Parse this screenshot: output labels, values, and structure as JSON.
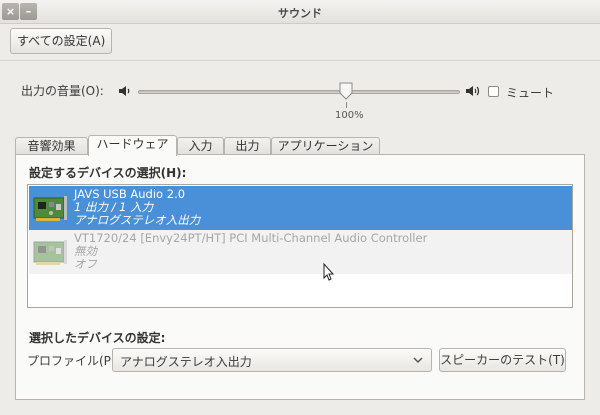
{
  "window": {
    "title": "サウンド",
    "close_glyph": "×",
    "min_glyph": "–"
  },
  "toolbar": {
    "all_settings_label": "すべての設定(A)"
  },
  "volume": {
    "label": "出力の音量(O):",
    "value_text": "100%",
    "level": 1.0,
    "mute_label": "ミュート",
    "mute_checked": false
  },
  "tabs": [
    {
      "label": "音響効果",
      "active": false
    },
    {
      "label": "ハードウェア",
      "active": true
    },
    {
      "label": "入力",
      "active": false
    },
    {
      "label": "出力",
      "active": false
    },
    {
      "label": "アプリケーション",
      "active": false
    }
  ],
  "hardware": {
    "device_section_label": "設定するデバイスの選択(H):",
    "devices": [
      {
        "name": "JAVS USB Audio 2.0",
        "io": "1 出力 / 1 入力",
        "profile": "アナログステレオ入出力",
        "selected": true,
        "enabled": true
      },
      {
        "name": "VT1720/24 [Envy24PT/HT] PCI Multi-Channel Audio Controller",
        "io": "無効",
        "profile": "オフ",
        "selected": false,
        "enabled": false
      }
    ],
    "settings_section_label": "選択したデバイスの設定:",
    "profile_label": "プロファイル(P):",
    "profile_value": "アナログステレオ入出力",
    "test_button_label": "スピーカーのテスト(T)"
  },
  "icons": {
    "speaker_low": "speaker-low-icon",
    "speaker_high": "speaker-high-icon",
    "sound_card": "sound-card-icon",
    "dropdown": "chevron-down-icon",
    "cursor": "mouse-pointer-icon"
  },
  "colors": {
    "selection": "#4a90d9",
    "background": "#edece9"
  }
}
